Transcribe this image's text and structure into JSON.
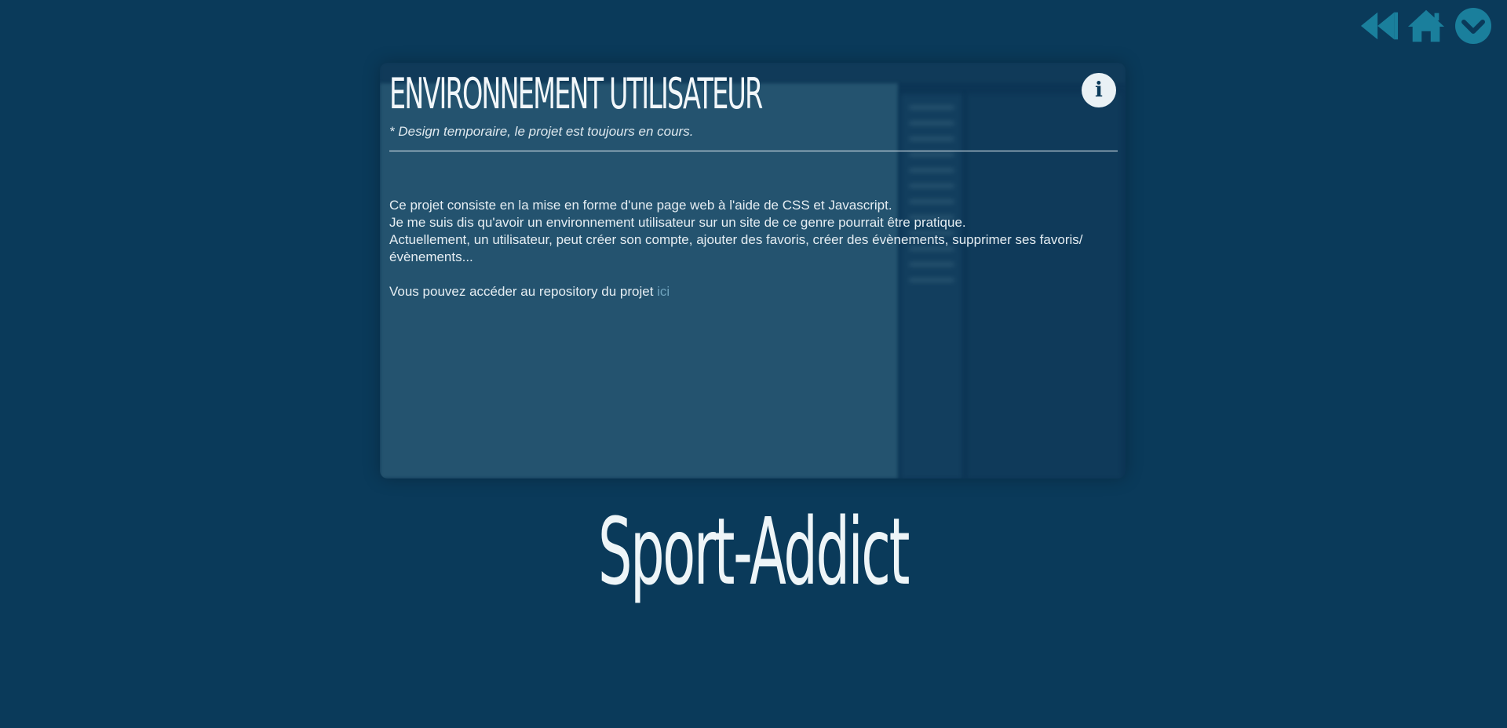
{
  "nav": {
    "back_icon": "double-chevron-left-icon",
    "home_icon": "home-icon",
    "down_icon": "chevron-down-circle-icon",
    "icon_color": "#1a7f9c"
  },
  "card": {
    "title": "Environnement utilisateur",
    "subtitle": "* Design temporaire, le projet est toujours en cours.",
    "description": [
      "Ce projet consiste en la mise en forme d'une page web à l'aide de CSS et Javascript.",
      "Je me suis dis qu'avoir un environnement utilisateur sur un site de ce genre pourrait être pratique.",
      "Actuellement, un utilisateur, peut créer son compte, ajouter des favoris, créer des évènements, supprimer ses favoris/évènements..."
    ],
    "repo_text": "Vous pouvez accéder au repository du projet ",
    "repo_link_label": "ici",
    "info_icon": "info-icon"
  },
  "project_name": "Sport-Addict",
  "colors": {
    "background": "#0a3a5a",
    "accent": "#1a7f9c",
    "text": "#e6f0f5",
    "link": "#6fa3bd"
  }
}
